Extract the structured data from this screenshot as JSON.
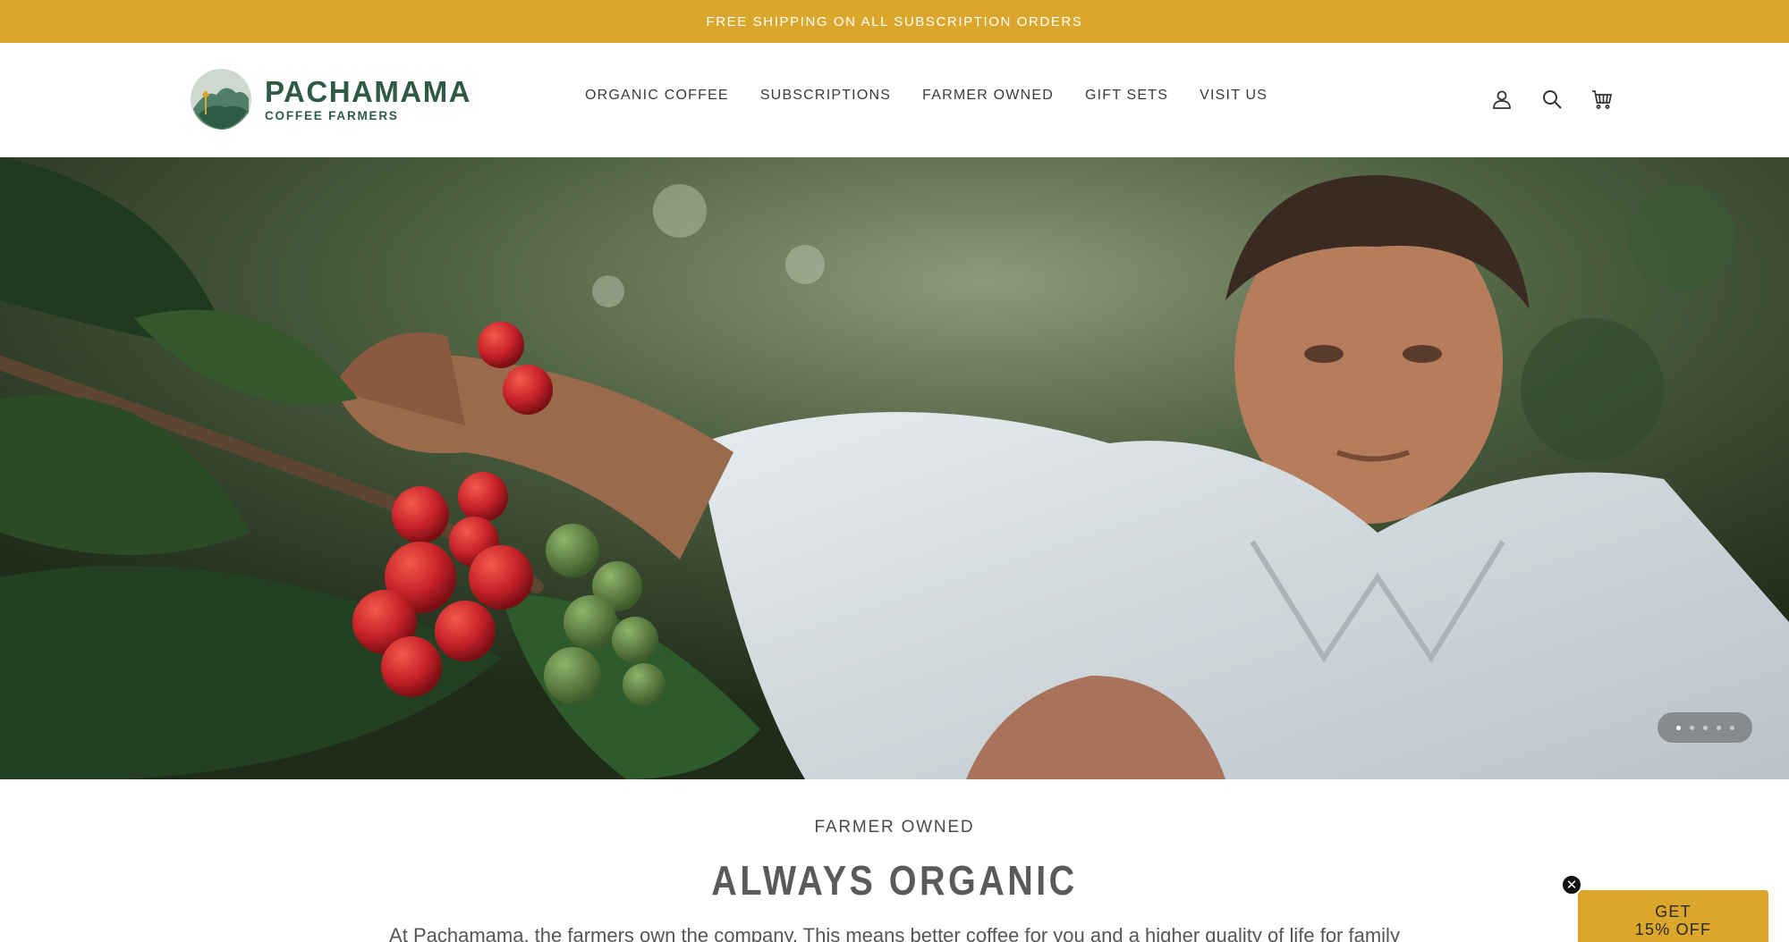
{
  "announcement": {
    "text": "FREE SHIPPING ON ALL SUBSCRIPTION ORDERS"
  },
  "brand": {
    "name": "PACHAMAMA",
    "tagline": "COFFEE FARMERS",
    "color": "#2f5a45",
    "accent": "#dba62c"
  },
  "nav": {
    "items": [
      {
        "label": "ORGANIC COFFEE"
      },
      {
        "label": "SUBSCRIPTIONS"
      },
      {
        "label": "FARMER OWNED"
      },
      {
        "label": "GIFT SETS"
      },
      {
        "label": "VISIT US"
      }
    ]
  },
  "header_icons": [
    "account-icon",
    "search-icon",
    "cart-icon"
  ],
  "hero": {
    "slide_count": 5,
    "active_slide": 1
  },
  "intro": {
    "eyebrow": "FARMER OWNED",
    "heading": "ALWAYS ORGANIC",
    "body": "At Pachamama, the farmers own the company. This means better coffee for you and a higher quality of life for family"
  },
  "promo": {
    "line1": "GET",
    "line2": "15% OFF"
  }
}
